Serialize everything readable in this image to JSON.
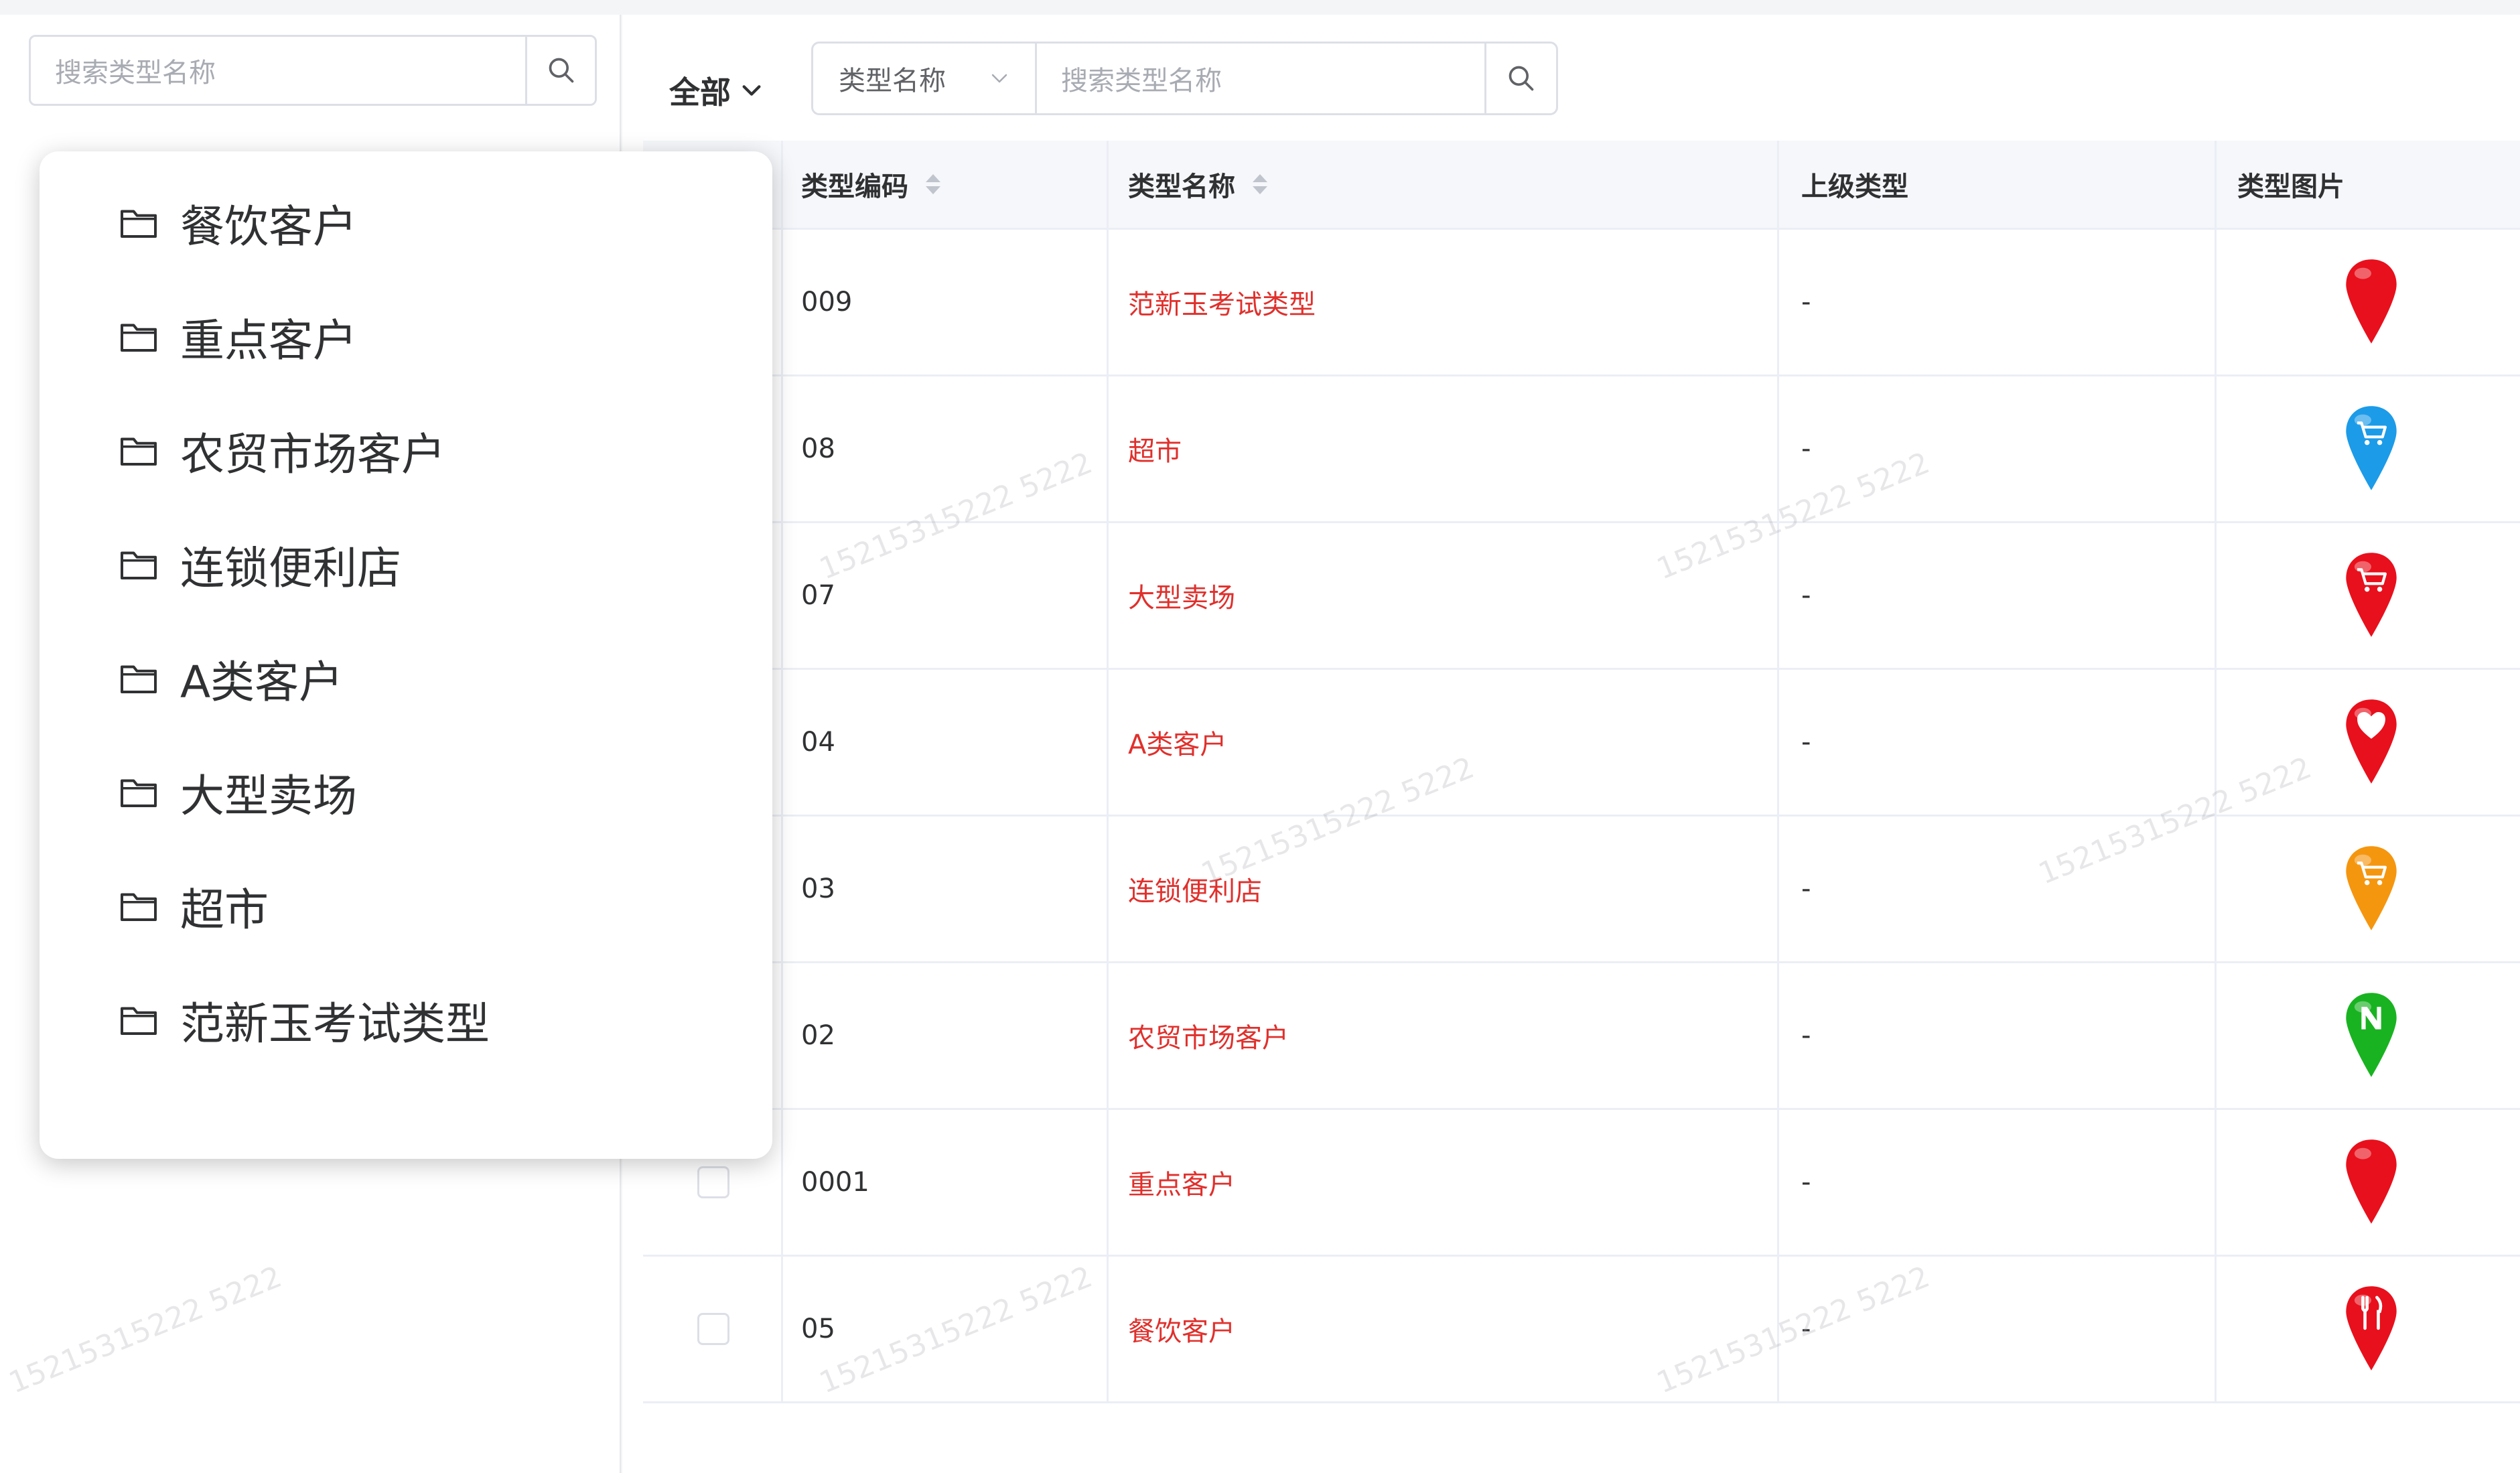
{
  "left_panel": {
    "search_placeholder": "搜索类型名称"
  },
  "filter": {
    "scope_label": "全部",
    "field_select": "类型名称",
    "search_placeholder": "搜索类型名称"
  },
  "table": {
    "columns": [
      "类型编码",
      "类型名称",
      "上级类型",
      "类型图片"
    ],
    "rows": [
      {
        "code": "009",
        "name": "范新玉考试类型",
        "parent": "-",
        "icon": "red-pin-icon",
        "color": "#e8101c"
      },
      {
        "code": "08",
        "name": "超市",
        "parent": "-",
        "icon": "blue-cart-pin-icon",
        "color": "#1c9be8"
      },
      {
        "code": "07",
        "name": "大型卖场",
        "parent": "-",
        "icon": "red-cart-pin-icon",
        "color": "#e8101c"
      },
      {
        "code": "04",
        "name": "A类客户",
        "parent": "-",
        "icon": "red-heart-pin-icon",
        "color": "#e8101c"
      },
      {
        "code": "03",
        "name": "连锁便利店",
        "parent": "-",
        "icon": "orange-cart-pin-icon",
        "color": "#f5960f"
      },
      {
        "code": "02",
        "name": "农贸市场客户",
        "parent": "-",
        "icon": "green-n-pin-icon",
        "color": "#19b321"
      },
      {
        "code": "0001",
        "name": "重点客户",
        "parent": "-",
        "icon": "red-pin-icon",
        "color": "#e8101c"
      },
      {
        "code": "05",
        "name": "餐饮客户",
        "parent": "-",
        "icon": "red-fork-pin-icon",
        "color": "#e8101c"
      }
    ]
  },
  "dropdown": {
    "items": [
      "餐饮客户",
      "重点客户",
      "农贸市场客户",
      "连锁便利店",
      "A类客户",
      "大型卖场",
      "超市",
      "范新玉考试类型"
    ]
  },
  "watermark_text": "15215315222 5222",
  "colors": {
    "accent_red": "#e0302c",
    "border": "#dcdfe6",
    "header_bg": "#f5f7fa"
  }
}
